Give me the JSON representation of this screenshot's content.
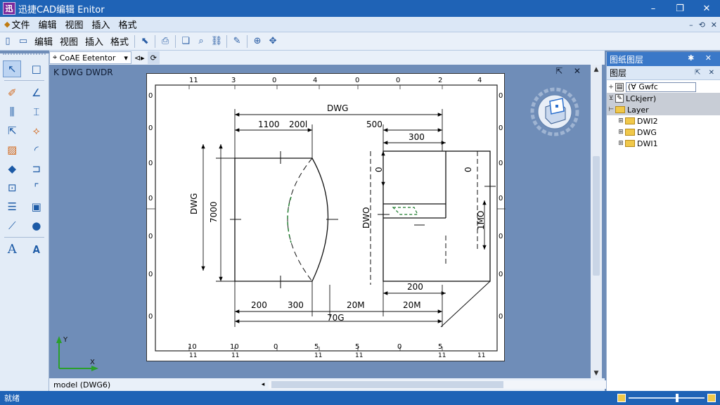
{
  "window": {
    "title": "迅捷CAD编辑 Enitor",
    "icon_label": "迅",
    "controls": [
      "–",
      "❐",
      "✕"
    ]
  },
  "menubar": {
    "items": [
      "文件",
      "编辑",
      "视图",
      "插入",
      "格式"
    ],
    "mdi_controls": [
      "–",
      "⟲",
      "✕"
    ]
  },
  "toolbar": {
    "labels": [
      "编辑",
      "视图",
      "插入",
      "格式"
    ]
  },
  "doc_tabs": {
    "active": "CoAE Eetentor",
    "dropdown": "▾"
  },
  "viewport": {
    "label": "K DWG DWDR",
    "corner_controls": "⇱ ✕"
  },
  "drawing": {
    "top_ruler": [
      "11",
      "3",
      "0",
      "4",
      "0",
      "0",
      "2",
      "4"
    ],
    "bottom_ruler": [
      "10",
      "10",
      "0",
      "5",
      "5",
      "0",
      "5"
    ],
    "bottom_ruler_sub": [
      "11",
      "11",
      "11",
      "11",
      "11",
      "11"
    ],
    "left_ruler": [
      "0",
      "0",
      "0",
      "0",
      "0",
      "0",
      "0"
    ],
    "right_ruler": [
      "0",
      "0",
      "0",
      "0",
      "0",
      "0",
      "0"
    ],
    "dims": {
      "overall_top": "DWG",
      "top_left_a": "1100",
      "top_left_b": "200l",
      "top_right": "500",
      "right_block_top": "300",
      "left_vertical_label": "DWG",
      "left_vertical_value": "7000",
      "mid_vertical_label": "DWO",
      "right_small_vertical": "0",
      "right_mid_vertical": "0",
      "right_vertical_value": "1MO",
      "mid_bottom": "200",
      "bottom_1": "200",
      "bottom_2": "300",
      "bottom_3": "20M",
      "bottom_4": "20M",
      "overall_bottom": "70G"
    }
  },
  "layout_bar": {
    "tab": "model (DWG6)",
    "arrows": [
      "◂",
      "▸"
    ]
  },
  "right_panel": {
    "title": "图纸图层",
    "title_pins": "✱ ✕",
    "sub_title": "图层",
    "sub_pins": "⇱ ✕",
    "search_value": "(Ɐ Gwfc",
    "tree": [
      {
        "label": "LCkjerr)",
        "kind": "box",
        "highlight": true
      },
      {
        "label": "Layer",
        "kind": "folder",
        "highlight": true
      },
      {
        "label": "DWI2",
        "kind": "folder",
        "highlight": false
      },
      {
        "label": "DWG",
        "kind": "folder",
        "highlight": false
      },
      {
        "label": "DWI1",
        "kind": "folder",
        "highlight": false
      }
    ]
  },
  "statusbar": {
    "text": "就绪",
    "zoom_fraction": 0.62
  },
  "colors": {
    "titlebar": "#1f63b6",
    "canvas_bg": "#6f8db8",
    "highlight": "#c8cdd6"
  }
}
